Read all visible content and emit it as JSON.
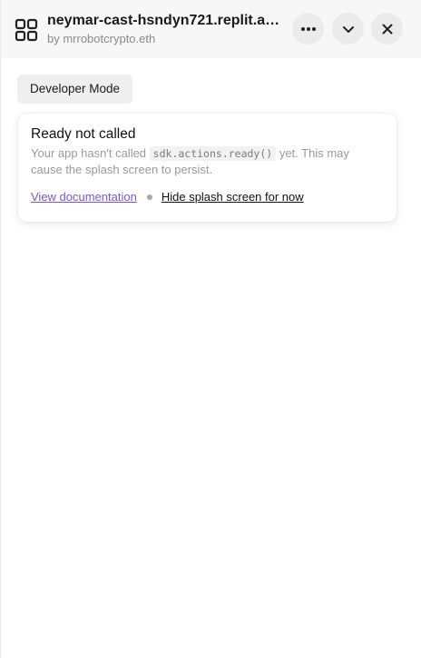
{
  "header": {
    "title": "neymar-cast-hsndyn721.replit.ap...",
    "subtitle": "by mrrobotcrypto.eth",
    "app_icon": "apps-grid-icon",
    "buttons": [
      {
        "icon": "more-horizontal-icon"
      },
      {
        "icon": "chevron-down-icon"
      },
      {
        "icon": "close-icon"
      }
    ]
  },
  "toolbar": {
    "developer_mode_label": "Developer Mode"
  },
  "notice": {
    "title": "Ready not called",
    "body_prefix": "Your app hasn't called ",
    "body_code": "sdk.actions.ready()",
    "body_suffix": " yet. This may cause the splash screen to persist.",
    "view_docs_label": "View documentation",
    "hide_splash_label": "Hide splash screen for now"
  },
  "colors": {
    "header_bg": "#f7f7f7",
    "button_bg": "#ebebeb",
    "link_accent": "#7b55d6"
  }
}
